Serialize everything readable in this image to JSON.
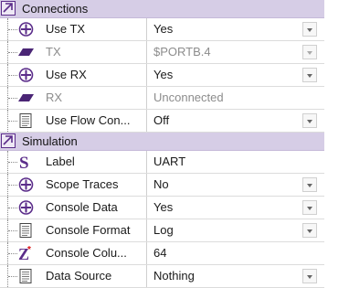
{
  "categories": [
    {
      "label": "Connections",
      "rows": [
        {
          "label": "Use TX",
          "value": "Yes",
          "icon": "plus-circle-icon",
          "disabled": false,
          "dropdown": true
        },
        {
          "label": "TX",
          "value": "$PORTB.4",
          "icon": "pin-parallelogram-icon",
          "disabled": true,
          "dropdown": true
        },
        {
          "label": "Use RX",
          "value": "Yes",
          "icon": "plus-circle-icon",
          "disabled": false,
          "dropdown": true
        },
        {
          "label": "RX",
          "value": "Unconnected",
          "icon": "pin-parallelogram-icon",
          "disabled": true,
          "dropdown": false
        },
        {
          "label": "Use Flow Con...",
          "value": "Off",
          "icon": "list-document-icon",
          "disabled": false,
          "dropdown": true
        }
      ]
    },
    {
      "label": "Simulation",
      "rows": [
        {
          "label": "Label",
          "value": "UART",
          "icon": "string-s-icon",
          "disabled": false,
          "dropdown": false
        },
        {
          "label": "Scope Traces",
          "value": "No",
          "icon": "plus-circle-icon",
          "disabled": false,
          "dropdown": true
        },
        {
          "label": "Console Data",
          "value": "Yes",
          "icon": "plus-circle-icon",
          "disabled": false,
          "dropdown": true
        },
        {
          "label": "Console Format",
          "value": "Log",
          "icon": "list-document-icon",
          "disabled": false,
          "dropdown": true
        },
        {
          "label": "Console Colu...",
          "value": "64",
          "icon": "integer-z-icon",
          "disabled": false,
          "dropdown": false
        },
        {
          "label": "Data Source",
          "value": "Nothing",
          "icon": "list-document-icon",
          "disabled": false,
          "dropdown": true
        }
      ]
    }
  ],
  "colors": {
    "category_bg": "#d6cde6",
    "icon_purple": "#5b2d8a",
    "disabled_text": "#8c8c8c"
  }
}
